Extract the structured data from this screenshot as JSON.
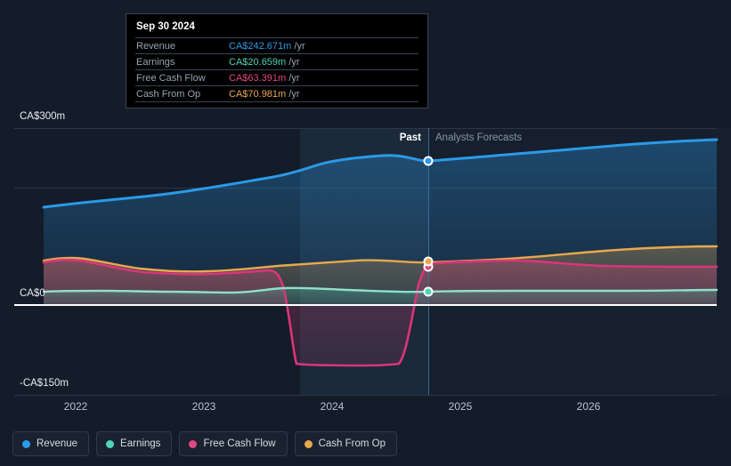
{
  "tooltip": {
    "date": "Sep 30 2024",
    "rows": [
      {
        "label": "Revenue",
        "value": "CA$242.671m",
        "unit": "/yr",
        "color": "#2b9ae8"
      },
      {
        "label": "Earnings",
        "value": "CA$20.659m",
        "unit": "/yr",
        "color": "#4ed5b8"
      },
      {
        "label": "Free Cash Flow",
        "value": "CA$63.391m",
        "unit": "/yr",
        "color": "#e0487f"
      },
      {
        "label": "Cash From Op",
        "value": "CA$70.981m",
        "unit": "/yr",
        "color": "#e8a84e"
      }
    ]
  },
  "periods": {
    "past": "Past",
    "forecast": "Analysts Forecasts"
  },
  "legend": [
    {
      "label": "Revenue",
      "color": "#2b9ae8"
    },
    {
      "label": "Earnings",
      "color": "#4ed5b8"
    },
    {
      "label": "Free Cash Flow",
      "color": "#e0487f"
    },
    {
      "label": "Cash From Op",
      "color": "#e8a84e"
    }
  ],
  "chart_data": {
    "type": "area",
    "title": "",
    "xlabel": "",
    "ylabel": "",
    "currency": "CA$",
    "units": "millions",
    "ylim": [
      -150,
      300
    ],
    "yticks": [
      300,
      0,
      -150
    ],
    "ytick_labels": [
      "CA$300m",
      "CA$0",
      "-CA$150m"
    ],
    "gridlines": [
      300,
      200,
      0
    ],
    "grid": true,
    "legend_position": "bottom-left",
    "forecast_start": "2024-10",
    "x": [
      "2021-08",
      "2021-11",
      "2022-02",
      "2022-05",
      "2022-08",
      "2022-11",
      "2023-02",
      "2023-05",
      "2023-08",
      "2023-11",
      "2024-02",
      "2024-05",
      "2024-09-30",
      "2024-12",
      "2025-03",
      "2025-06",
      "2025-09",
      "2025-12",
      "2026-03",
      "2026-06",
      "2026-09",
      "2026-12"
    ],
    "xtick_labels": [
      "2022",
      "2023",
      "2024",
      "2025",
      "2026"
    ],
    "series": [
      {
        "name": "Revenue",
        "color": "#2b9ae8",
        "values": [
          165,
          172,
          178,
          185,
          190,
          196,
          200,
          206,
          211,
          216,
          225,
          236,
          242.671,
          247,
          251,
          255,
          258,
          262,
          266,
          270,
          275,
          280
        ]
      },
      {
        "name": "Earnings",
        "color": "#4ed5b8",
        "values": [
          22,
          23,
          23,
          24,
          24,
          23,
          22,
          22,
          25,
          25,
          23,
          21,
          20.659,
          21,
          21,
          22,
          22,
          22,
          23,
          23,
          24,
          24
        ]
      },
      {
        "name": "Free Cash Flow",
        "color": "#e0487f",
        "values": [
          72,
          76,
          74,
          66,
          60,
          58,
          58,
          59,
          5,
          -117,
          -118,
          -112,
          63.391,
          58,
          60,
          62,
          63,
          64,
          64,
          65,
          65,
          65
        ]
      },
      {
        "name": "Cash From Op",
        "color": "#e8a84e",
        "values": [
          75,
          80,
          78,
          70,
          63,
          61,
          61,
          62,
          64,
          68,
          70,
          74,
          70.981,
          72,
          72,
          74,
          77,
          80,
          82,
          84,
          86,
          88
        ]
      }
    ]
  }
}
